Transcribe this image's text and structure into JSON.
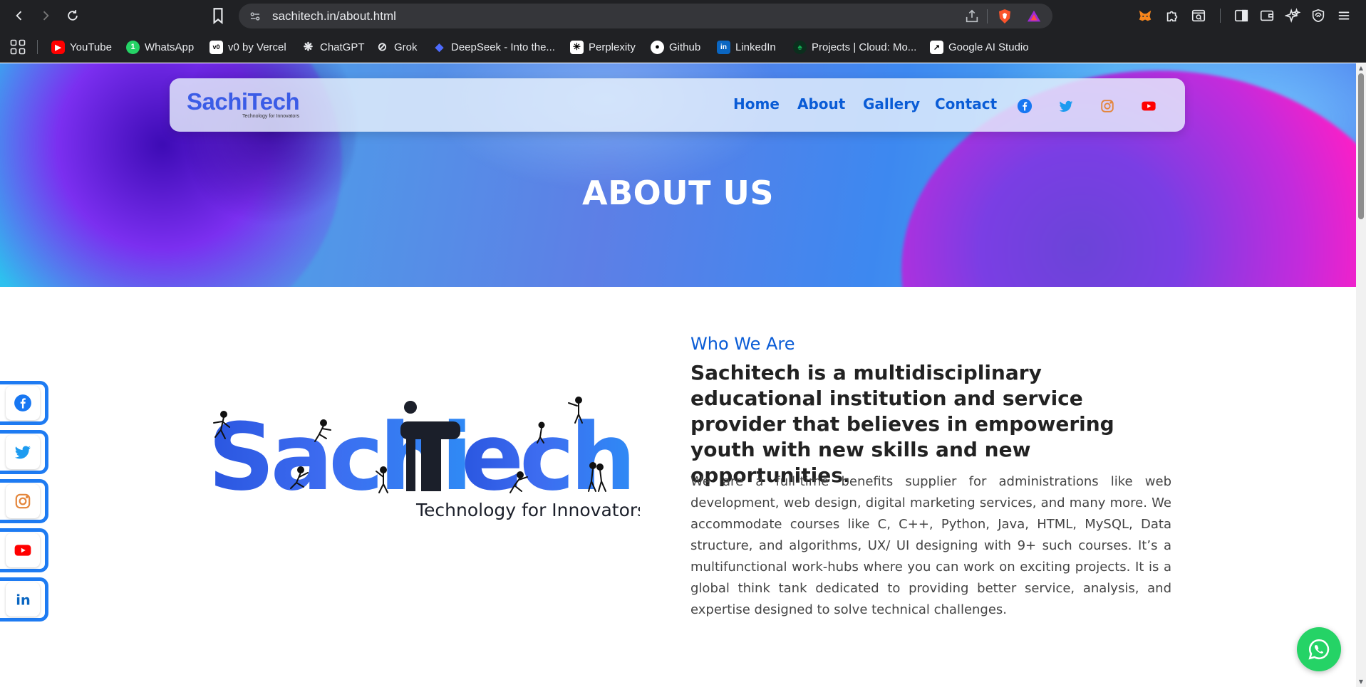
{
  "browser": {
    "url": "sachitech.in/about.html",
    "bookmarks": [
      {
        "label": "YouTube",
        "icon": "youtube-icon",
        "color": "#ff0000"
      },
      {
        "label": "WhatsApp",
        "icon": "whatsapp-icon",
        "color": "#25d366"
      },
      {
        "label": "v0 by Vercel",
        "icon": "v0-icon",
        "color": "#ffffff"
      },
      {
        "label": "ChatGPT",
        "icon": "chatgpt-icon",
        "color": "#e8eaed"
      },
      {
        "label": "Grok",
        "icon": "grok-icon",
        "color": "#e8eaed"
      },
      {
        "label": "DeepSeek - Into the...",
        "icon": "deepseek-icon",
        "color": "#4d6bfe"
      },
      {
        "label": "Perplexity",
        "icon": "perplexity-icon",
        "color": "#ffffff"
      },
      {
        "label": "Github",
        "icon": "github-icon",
        "color": "#ffffff"
      },
      {
        "label": "LinkedIn",
        "icon": "linkedin-icon",
        "color": "#0a66c2"
      },
      {
        "label": "Projects | Cloud: Mo...",
        "icon": "mongodb-icon",
        "color": "#13aa52"
      },
      {
        "label": "Google AI Studio",
        "icon": "ai-studio-icon",
        "color": "#ffffff"
      }
    ]
  },
  "site": {
    "logo_text": "SachiTech",
    "logo_tagline": "Technology for Innovators",
    "nav": {
      "home": "Home",
      "about": "About",
      "gallery": "Gallery",
      "contact": "Contact"
    },
    "hero_title": "ABOUT US",
    "about_logo_text": "SachiTech",
    "about_logo_tagline": "Technology for Innovators",
    "who_heading": "Who We Are",
    "who_lead": "Sachitech is a multidisciplinary educational institution and service provider that believes in empowering youth with new skills and new opportunities.",
    "who_body": "We are a full-time benefits supplier for administrations like web development, web design, digital marketing services, and many more. We accommodate courses like C, C++, Python, Java, HTML, MySQL, Data structure, and algorithms, UX/ UI designing with 9+ such courses. It’s a multifunctional work-hubs where you can work on exciting projects. It is a global think tank dedicated to providing better service, analysis, and expertise designed to solve technical challenges."
  },
  "colors": {
    "brand_blue": "#0a5cd6",
    "logo_blue": "#3b5ce6",
    "sidebar_border": "#1e7bf2",
    "whatsapp_green": "#25d366"
  }
}
